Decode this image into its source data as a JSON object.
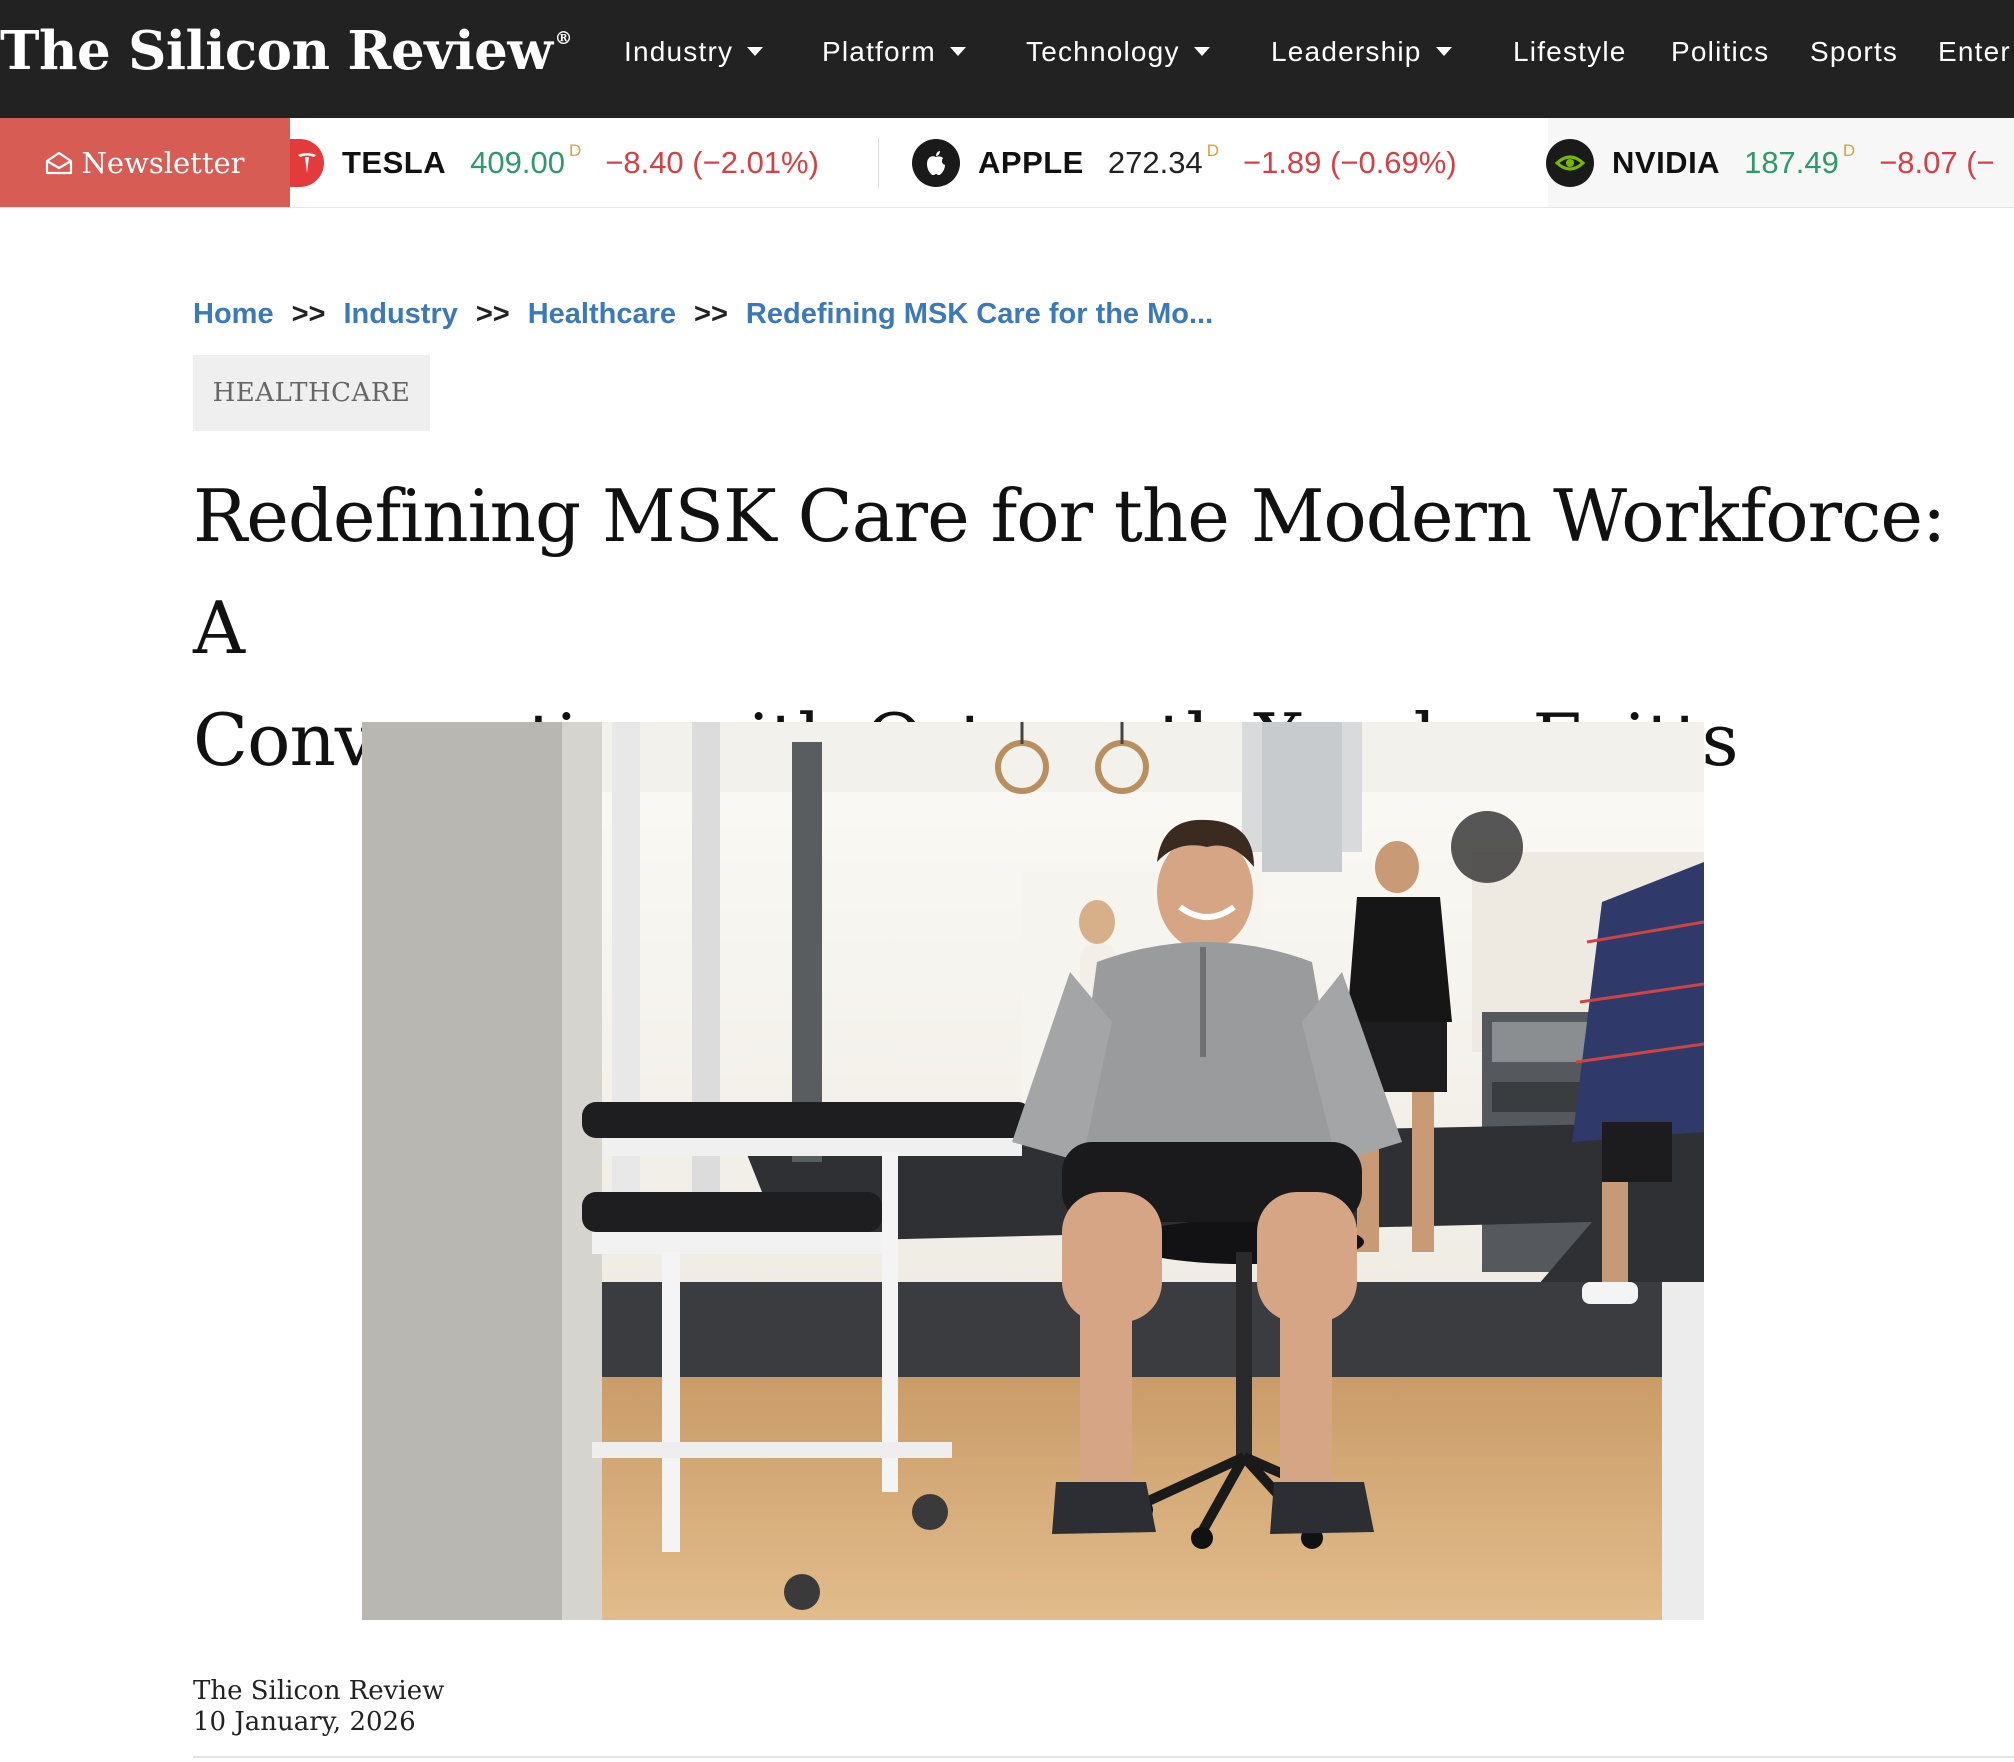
{
  "site": {
    "logo_text": "The Silicon Review",
    "logo_mark": "®"
  },
  "nav": {
    "items": [
      {
        "label": "Industry",
        "dropdown": true
      },
      {
        "label": "Platform",
        "dropdown": true
      },
      {
        "label": "Technology",
        "dropdown": true
      },
      {
        "label": "Leadership",
        "dropdown": true
      },
      {
        "label": "Lifestyle",
        "dropdown": false
      },
      {
        "label": "Politics",
        "dropdown": false
      },
      {
        "label": "Sports",
        "dropdown": false
      },
      {
        "label": "Enter",
        "dropdown": false
      }
    ]
  },
  "newsletter": {
    "label": "Newsletter",
    "icon": "envelope-open-icon"
  },
  "ticker": [
    {
      "name": "TESLA",
      "price": "409.00",
      "flag": "D",
      "change": "−8.40 (−2.01%)",
      "icon": "tesla-logo-icon",
      "price_color": "#2e9a6a",
      "change_color": "#d64045"
    },
    {
      "name": "APPLE",
      "price": "272.34",
      "flag": "D",
      "change": "−1.89 (−0.69%)",
      "icon": "apple-logo-icon",
      "price_color": "#222222",
      "change_color": "#d64045"
    },
    {
      "name": "NVIDIA",
      "price": "187.49",
      "flag": "D",
      "change": "−8.07 (−",
      "icon": "nvidia-logo-icon",
      "price_color": "#2e9a6a",
      "change_color": "#d64045"
    }
  ],
  "breadcrumb": {
    "items": [
      "Home",
      "Industry",
      "Healthcare",
      "Redefining MSK Care for the Mo..."
    ],
    "separator": ">>"
  },
  "article": {
    "category": "HEALTHCARE",
    "title_line1": "Redefining MSK Care for the Modern Workforce: A",
    "title_line2": "Conversation with Osteopath Xander Evitts",
    "author": "The Silicon Review",
    "date": "10 January, 2026"
  },
  "colors": {
    "topbar": "#222222",
    "newsletter_bg": "#d65c54",
    "link_blue": "#3c79b8",
    "price_green": "#2e9a6a",
    "change_red": "#d64045"
  }
}
